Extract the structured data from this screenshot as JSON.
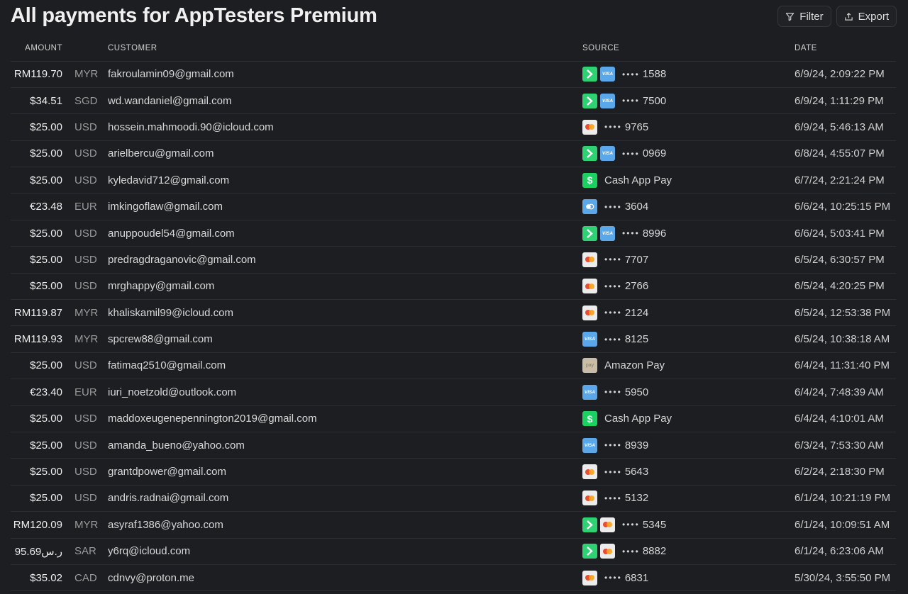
{
  "page": {
    "title": "All payments for AppTesters Premium"
  },
  "toolbar": {
    "filter_label": "Filter",
    "export_label": "Export"
  },
  "table": {
    "headers": {
      "amount": "AMOUNT",
      "customer": "CUSTOMER",
      "source": "SOURCE",
      "date": "DATE"
    },
    "rows": [
      {
        "amount": "RM119.70",
        "currency": "MYR",
        "customer": "fakroulamin09@gmail.com",
        "source_icons": [
          "link-icon",
          "visa-icon"
        ],
        "masked": "••••",
        "last4": "1588",
        "source_label": "",
        "date": "6/9/24, 2:09:22 PM"
      },
      {
        "amount": "$34.51",
        "currency": "SGD",
        "customer": "wd.wandaniel@gmail.com",
        "source_icons": [
          "link-icon",
          "visa-icon"
        ],
        "masked": "••••",
        "last4": "7500",
        "source_label": "",
        "date": "6/9/24, 1:11:29 PM"
      },
      {
        "amount": "$25.00",
        "currency": "USD",
        "customer": "hossein.mahmoodi.90@icloud.com",
        "source_icons": [
          "mastercard-icon"
        ],
        "masked": "••••",
        "last4": "9765",
        "source_label": "",
        "date": "6/9/24, 5:46:13 AM"
      },
      {
        "amount": "$25.00",
        "currency": "USD",
        "customer": "arielbercu@gmail.com",
        "source_icons": [
          "link-icon",
          "visa-icon"
        ],
        "masked": "••••",
        "last4": "0969",
        "source_label": "",
        "date": "6/8/24, 4:55:07 PM"
      },
      {
        "amount": "$25.00",
        "currency": "USD",
        "customer": "kyledavid712@gmail.com",
        "source_icons": [
          "cashapp-icon"
        ],
        "masked": "",
        "last4": "",
        "source_label": "Cash App Pay",
        "date": "6/7/24, 2:21:24 PM"
      },
      {
        "amount": "€23.48",
        "currency": "EUR",
        "customer": "imkingoflaw@gmail.com",
        "source_icons": [
          "card-icon"
        ],
        "masked": "••••",
        "last4": "3604",
        "source_label": "",
        "date": "6/6/24, 10:25:15 PM"
      },
      {
        "amount": "$25.00",
        "currency": "USD",
        "customer": "anuppoudel54@gmail.com",
        "source_icons": [
          "link-icon",
          "visa-icon"
        ],
        "masked": "••••",
        "last4": "8996",
        "source_label": "",
        "date": "6/6/24, 5:03:41 PM"
      },
      {
        "amount": "$25.00",
        "currency": "USD",
        "customer": "predragdraganovic@gmail.com",
        "source_icons": [
          "mastercard-icon"
        ],
        "masked": "••••",
        "last4": "7707",
        "source_label": "",
        "date": "6/5/24, 6:30:57 PM"
      },
      {
        "amount": "$25.00",
        "currency": "USD",
        "customer": "mrghappy@gmail.com",
        "source_icons": [
          "mastercard-icon"
        ],
        "masked": "••••",
        "last4": "2766",
        "source_label": "",
        "date": "6/5/24, 4:20:25 PM"
      },
      {
        "amount": "RM119.87",
        "currency": "MYR",
        "customer": "khaliskamil99@icloud.com",
        "source_icons": [
          "mastercard-icon"
        ],
        "masked": "••••",
        "last4": "2124",
        "source_label": "",
        "date": "6/5/24, 12:53:38 PM"
      },
      {
        "amount": "RM119.93",
        "currency": "MYR",
        "customer": "spcrew88@gmail.com",
        "source_icons": [
          "visa-icon"
        ],
        "masked": "••••",
        "last4": "8125",
        "source_label": "",
        "date": "6/5/24, 10:38:18 AM"
      },
      {
        "amount": "$25.00",
        "currency": "USD",
        "customer": "fatimaq2510@gmail.com",
        "source_icons": [
          "amazonpay-icon"
        ],
        "masked": "",
        "last4": "",
        "source_label": "Amazon Pay",
        "date": "6/4/24, 11:31:40 PM"
      },
      {
        "amount": "€23.40",
        "currency": "EUR",
        "customer": "iuri_noetzold@outlook.com",
        "source_icons": [
          "visa-icon"
        ],
        "masked": "••••",
        "last4": "5950",
        "source_label": "",
        "date": "6/4/24, 7:48:39 AM"
      },
      {
        "amount": "$25.00",
        "currency": "USD",
        "customer": "maddoxeugenepennington2019@gmail.com",
        "source_icons": [
          "cashapp-icon"
        ],
        "masked": "",
        "last4": "",
        "source_label": "Cash App Pay",
        "date": "6/4/24, 4:10:01 AM"
      },
      {
        "amount": "$25.00",
        "currency": "USD",
        "customer": "amanda_bueno@yahoo.com",
        "source_icons": [
          "visa-icon"
        ],
        "masked": "••••",
        "last4": "8939",
        "source_label": "",
        "date": "6/3/24, 7:53:30 AM"
      },
      {
        "amount": "$25.00",
        "currency": "USD",
        "customer": "grantdpower@gmail.com",
        "source_icons": [
          "mastercard-icon"
        ],
        "masked": "••••",
        "last4": "5643",
        "source_label": "",
        "date": "6/2/24, 2:18:30 PM"
      },
      {
        "amount": "$25.00",
        "currency": "USD",
        "customer": "andris.radnai@gmail.com",
        "source_icons": [
          "mastercard-icon"
        ],
        "masked": "••••",
        "last4": "5132",
        "source_label": "",
        "date": "6/1/24, 10:21:19 PM"
      },
      {
        "amount": "RM120.09",
        "currency": "MYR",
        "customer": "asyraf1386@yahoo.com",
        "source_icons": [
          "link-icon",
          "mastercard-icon"
        ],
        "masked": "••••",
        "last4": "5345",
        "source_label": "",
        "date": "6/1/24, 10:09:51 AM"
      },
      {
        "amount": "95.69‫ر.س‬",
        "currency": "SAR",
        "customer": "y6rq@icloud.com",
        "source_icons": [
          "link-icon",
          "mastercard-icon"
        ],
        "masked": "••••",
        "last4": "8882",
        "source_label": "",
        "date": "6/1/24, 6:23:06 AM"
      },
      {
        "amount": "$35.02",
        "currency": "CAD",
        "customer": "cdnvy@proton.me",
        "source_icons": [
          "mastercard-icon"
        ],
        "masked": "••••",
        "last4": "6831",
        "source_label": "",
        "date": "5/30/24, 3:55:50 PM"
      }
    ]
  }
}
